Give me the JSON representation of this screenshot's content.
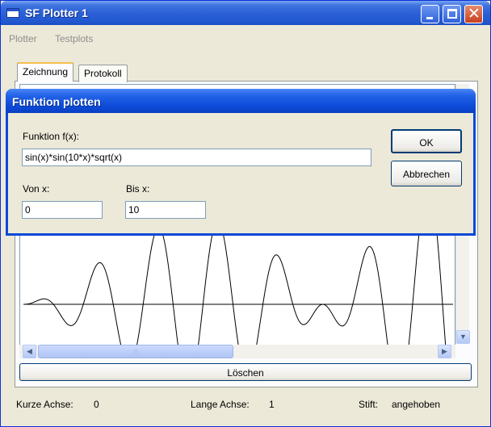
{
  "window": {
    "title": "SF Plotter 1"
  },
  "menu": {
    "items": [
      "Plotter",
      "Testplots"
    ]
  },
  "tabs": [
    "Zeichnung",
    "Protokoll"
  ],
  "plot": {
    "function": "sin(x)*sin(10*x)*sqrt(x)",
    "x_range": [
      0,
      10
    ],
    "line_color": "#000000"
  },
  "buttons": {
    "clear": "Löschen"
  },
  "status": {
    "short_axis_label": "Kurze Achse:",
    "short_axis_value": "0",
    "long_axis_label": "Lange Achse:",
    "long_axis_value": "1",
    "pen_label": "Stift:",
    "pen_value": "angehoben"
  },
  "dialog": {
    "title": "Funktion plotten",
    "function_label": "Funktion f(x):",
    "function_value": "sin(x)*sin(10*x)*sqrt(x)",
    "from_label": "Von x:",
    "from_value": "0",
    "to_label": "Bis x:",
    "to_value": "10",
    "ok": "OK",
    "cancel": "Abbrechen"
  },
  "colors": {
    "title_blue": "#2258cf",
    "dialog_blue": "#0c4bd9",
    "face": "#ece9d8"
  }
}
